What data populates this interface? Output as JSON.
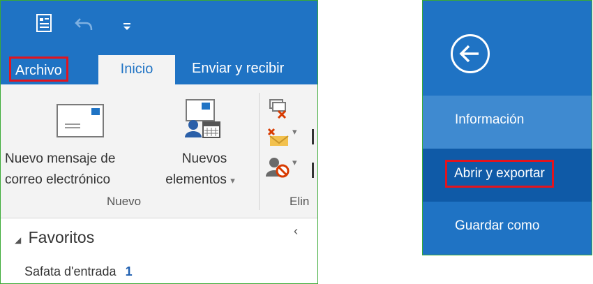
{
  "left": {
    "tabs": {
      "archivo": "Archivo",
      "inicio": "Inicio",
      "enviar": "Enviar y recibir"
    },
    "ribbon": {
      "new_email_line1": "Nuevo mensaje de",
      "new_email_line2": "correo electrónico",
      "new_items_line1": "Nuevos",
      "new_items_line2": "elementos",
      "dropdown_glyph": "▾",
      "group_nuevo": "Nuevo",
      "group_eliminar": "Elin"
    },
    "nav": {
      "favorites": "Favoritos",
      "favorites_glyph": "◢",
      "collapse_glyph": "‹",
      "inbox_label": "Safata d'entrada",
      "inbox_count": "1"
    }
  },
  "right": {
    "menu": {
      "info": "Información",
      "open_export": "Abrir y exportar",
      "save_as": "Guardar como"
    }
  },
  "colors": {
    "ribbon_blue": "#1f73c4",
    "highlight_red": "#e2141e",
    "frame_green": "#3aaa35"
  },
  "icons": [
    "outlook-app-icon",
    "undo-icon",
    "qat-dropdown-icon",
    "envelope-icon",
    "new-items-icon",
    "ignore-icon",
    "clean-up-icon",
    "junk-icon",
    "back-arrow-icon"
  ]
}
